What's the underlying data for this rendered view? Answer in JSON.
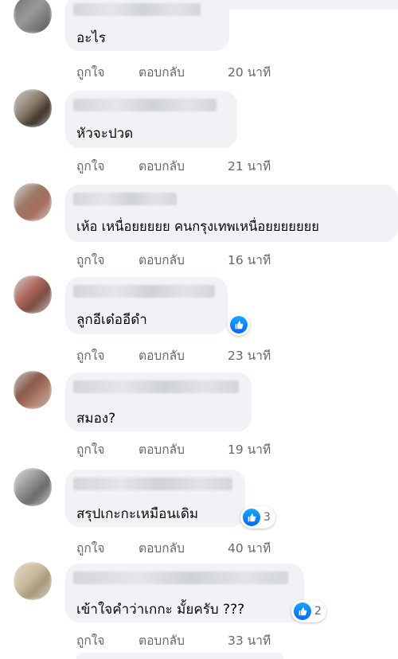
{
  "action_labels": {
    "like": "ถูกใจ",
    "reply": "ตอบกลับ"
  },
  "comments": [
    {
      "text": "อะไร",
      "time": "20 นาที"
    },
    {
      "text": "หัวจะปวด",
      "time": "21 นาที"
    },
    {
      "text": "เห้อ เหนื่อยยยยย คนกรุงเทพเหนื่อยยยยยยย",
      "time": "16 นาที"
    },
    {
      "text": "ลูกอีเด๋ออีดำ",
      "time": "23 นาที",
      "reactions": {
        "icon": "like-icon"
      }
    },
    {
      "text": "สมอง?",
      "time": "19 นาที"
    },
    {
      "text": "สรุปเกะกะเหมือนเดิม",
      "time": "40 นาที",
      "reactions": {
        "icon": "like-icon",
        "count": "3"
      }
    },
    {
      "text": "เข้าใจคำว่าเกกะ มั้ยครับ ???",
      "time": "33 นาที",
      "reactions": {
        "icon": "like-icon",
        "count": "2"
      }
    }
  ],
  "colors": {
    "bubble": "#f0f2f5",
    "action_text": "#65676b",
    "like_blue": "#0866ff"
  }
}
